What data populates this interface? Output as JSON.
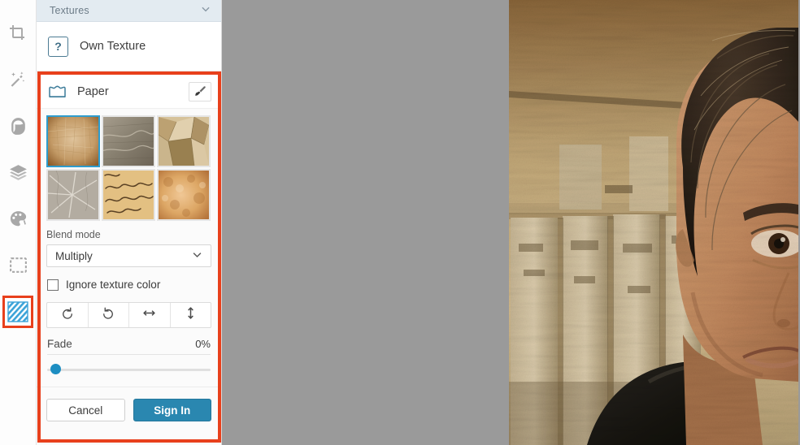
{
  "sidebar": {
    "items": [
      {
        "name": "crop-tool",
        "icon": "crop-icon",
        "selected": false
      },
      {
        "name": "magic-wand-tool",
        "icon": "magic-wand-icon",
        "selected": false
      },
      {
        "name": "portrait-tool",
        "icon": "portrait-icon",
        "selected": false
      },
      {
        "name": "layers-tool",
        "icon": "layers-icon",
        "selected": false
      },
      {
        "name": "palette-tool",
        "icon": "palette-icon",
        "selected": false
      },
      {
        "name": "frame-tool",
        "icon": "frame-icon",
        "selected": false
      },
      {
        "name": "textures-tool",
        "icon": "texture-icon",
        "selected": true
      }
    ]
  },
  "panel": {
    "header_title": "Textures",
    "header_chevron": "chevron-down-icon",
    "own_texture": {
      "label": "Own Texture",
      "icon": "question-mark-icon"
    },
    "paper_section": {
      "label": "Paper",
      "icon": "paper-icon",
      "brush_icon": "brush-icon",
      "thumbnails": [
        {
          "name": "texture-beige-grain",
          "selected": true,
          "c1": "#d9b98c",
          "c2": "#9c6b38"
        },
        {
          "name": "texture-gray-marble",
          "selected": false,
          "c1": "#9b9486",
          "c2": "#6e675a"
        },
        {
          "name": "texture-crumpled-paper",
          "selected": false,
          "c1": "#d8c9a7",
          "c2": "#8a7040"
        },
        {
          "name": "texture-cracked-gray",
          "selected": false,
          "c1": "#bdb6ab",
          "c2": "#8d867c"
        },
        {
          "name": "texture-handwritten-note",
          "selected": false,
          "c1": "#e8c88f",
          "c2": "#c59450"
        },
        {
          "name": "texture-orange-grain",
          "selected": false,
          "c1": "#e2b07a",
          "c2": "#c07b3c"
        }
      ]
    },
    "blend_mode": {
      "label": "Blend mode",
      "value": "Multiply",
      "chevron": "chevron-down-icon"
    },
    "ignore_texture_color": {
      "label": "Ignore texture color",
      "checked": false
    },
    "transform_buttons": [
      {
        "name": "rotate-left-button",
        "icon": "rotate-ccw-icon"
      },
      {
        "name": "rotate-right-button",
        "icon": "rotate-cw-icon"
      },
      {
        "name": "flip-horizontal-button",
        "icon": "arrows-horizontal-icon"
      },
      {
        "name": "flip-vertical-button",
        "icon": "arrows-vertical-icon"
      }
    ],
    "fade": {
      "label": "Fade",
      "value": "0%",
      "percent": 0
    },
    "actions": {
      "cancel_label": "Cancel",
      "signin_label": "Sign In"
    }
  },
  "canvas": {
    "background_color": "#9a9a9a",
    "photo": {
      "name": "edited-portrait-photo",
      "description": "Sepia-toned portrait of a person in a black shirt in front of a weathered stone fence"
    }
  },
  "highlight": {
    "color": "#e8401c",
    "regions": [
      "paper-texture-section",
      "textures-tool-icon"
    ]
  }
}
